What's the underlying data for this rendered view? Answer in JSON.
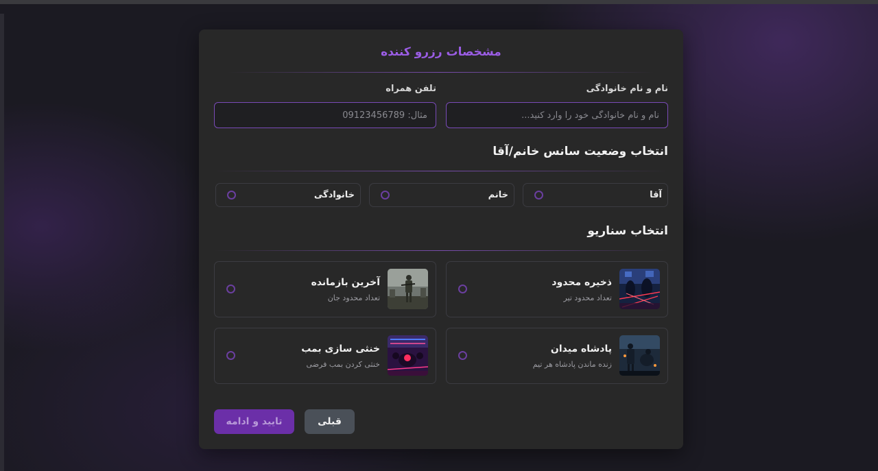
{
  "form": {
    "title": "مشخصات رزرو کننده",
    "name_label": "نام و نام خانوادگی",
    "name_placeholder": "نام و نام خانوادگی خود را وارد کنید...",
    "name_value": "",
    "phone_label": "تلفن همراه",
    "phone_placeholder": "مثال: 09123456789",
    "phone_value": ""
  },
  "session": {
    "title": "انتخاب وضعیت سانس خانم/آقا",
    "options": [
      {
        "label": "آقا",
        "selected": false
      },
      {
        "label": "خانم",
        "selected": false
      },
      {
        "label": "خانوادگی",
        "selected": false
      }
    ]
  },
  "scenario": {
    "title": "انتخاب سناریو",
    "items": [
      {
        "title": "ذخیره محدود",
        "subtitle": "تعداد محدود تیر",
        "image": "limited-ammo-image",
        "selected": false
      },
      {
        "title": "آخرین بازمانده",
        "subtitle": "تعداد محدود جان",
        "image": "last-survivor-image",
        "selected": false
      },
      {
        "title": "پادشاه میدان",
        "subtitle": "زنده ماندن پادشاه هر تیم",
        "image": "king-of-field-image",
        "selected": false
      },
      {
        "title": "خنثی سازی بمب",
        "subtitle": "خنثی کردن بمب فرضی",
        "image": "bomb-defuse-image",
        "selected": false
      }
    ]
  },
  "actions": {
    "back_label": "قبلی",
    "next_label": "تایید و ادامه"
  },
  "colors": {
    "accent": "#9b5de5",
    "card_bg": "#282828",
    "next_button": "#6b2fa8",
    "back_button": "#4a5058"
  }
}
